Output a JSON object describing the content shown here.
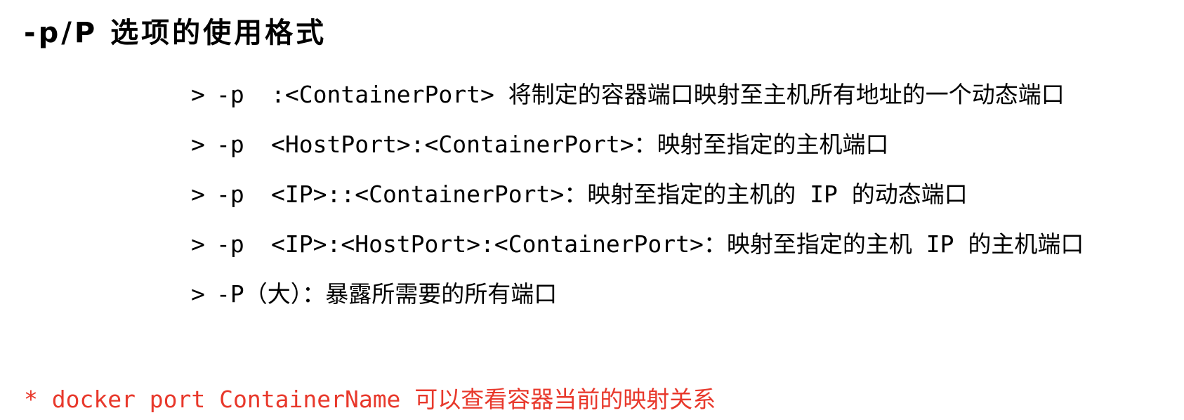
{
  "title": "-p/P 选项的使用格式",
  "bullet_glyph": ">",
  "options": [
    {
      "flag": "-p",
      "desc": " :<ContainerPort> 将制定的容器端口映射至主机所有地址的一个动态端口"
    },
    {
      "flag": "-p",
      "desc": " <HostPort>:<ContainerPort>：映射至指定的主机端口"
    },
    {
      "flag": "-p",
      "desc": " <IP>::<ContainerPort>：映射至指定的主机的 IP 的动态端口"
    },
    {
      "flag": "-p",
      "desc": " <IP>:<HostPort>:<ContainerPort>：映射至指定的主机 IP 的主机端口"
    },
    {
      "flag": "-P",
      "desc": "（大）：暴露所需要的所有端口"
    }
  ],
  "footnote": "* docker port ContainerName 可以查看容器当前的映射关系",
  "colors": {
    "text": "#000000",
    "footnote": "#e8382b",
    "background": "#ffffff"
  }
}
